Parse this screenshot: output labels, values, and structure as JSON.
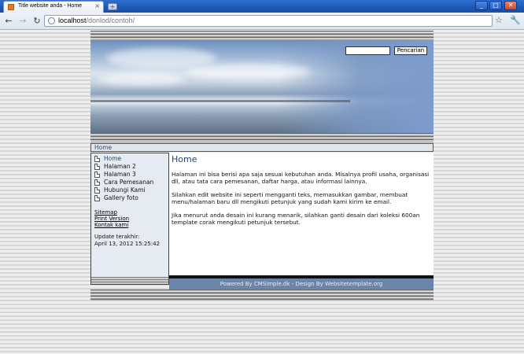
{
  "browser": {
    "tab_title": "Title website anda - Home",
    "tab_close": "×",
    "new_tab": "+",
    "window_buttons": {
      "minimize": "_",
      "maximize": "□",
      "close": "✕"
    },
    "url_host": "localhost",
    "url_path": "/donlod/contoh/",
    "nav": {
      "back": "←",
      "forward": "→",
      "reload": "↻"
    },
    "star": "☆",
    "wrench": "🔧"
  },
  "site": {
    "search": {
      "placeholder": "",
      "button_label": "Pencarian"
    },
    "breadcrumb": "Home",
    "menu": [
      {
        "label": "Home",
        "active": true
      },
      {
        "label": "Halaman 2"
      },
      {
        "label": "Halaman 3"
      },
      {
        "label": "Cara Pemesanan"
      },
      {
        "label": "Hubungi Kami"
      },
      {
        "label": "Gallery foto"
      }
    ],
    "links": {
      "sitemap": "Sitemap",
      "print": "Print Version",
      "contact": "Kontak kami"
    },
    "updated_label": "Update terakhir:",
    "updated_value": "April 13, 2012 15:25:42",
    "page_title": "Home",
    "paragraphs": [
      "Halaman ini bisa berisi apa saja sesuai kebutuhan anda. Misalnya profil usaha, organisasi dll, atau tata cara pemesanan, daftar harga, atau informasi lainnya.",
      "Silahkan edit website ini seperti mengganti teks, memasukkan gambar, membuat menu/halaman baru dll mengikuti petunjuk yang sudah kami kirim ke email.",
      "Jika menurut anda desain ini kurang menarik, silahkan ganti desain dari koleksi 600an template corak mengikuti petunjuk tersebut."
    ],
    "footer": "Powered By CMSimple.dk - Design By Websitetemplate.org"
  }
}
